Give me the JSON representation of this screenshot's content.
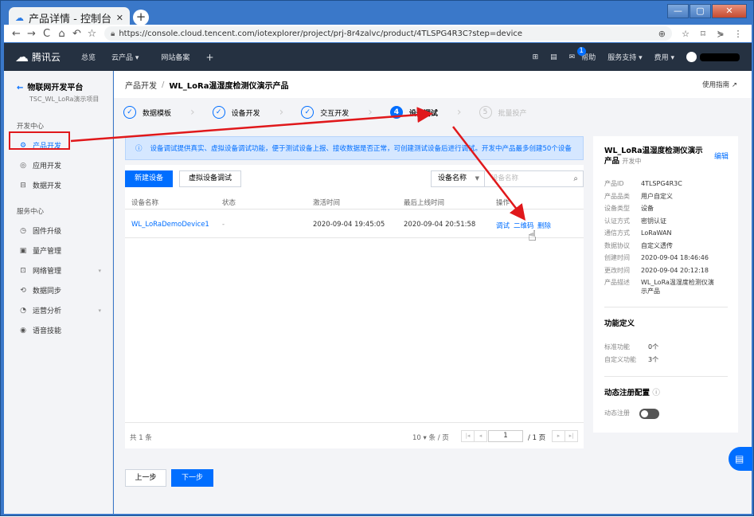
{
  "browser": {
    "tab_title": "产品详情 - 控制台",
    "tab_close": "✕",
    "new_tab": "+",
    "url": "https://console.cloud.tencent.com/iotexplorer/project/prj-8r4zalvc/product/4TLSPG4R3C?step=device",
    "nav": [
      "←",
      "→",
      "C",
      "⌂",
      "↶",
      "☆"
    ],
    "tools": [
      "⊕",
      "☆",
      "⌑",
      "⋟",
      "⋮"
    ]
  },
  "topnav": {
    "brand": "腾讯云",
    "items": [
      "总览",
      "云产品 ▾",
      "网站备案",
      "+"
    ],
    "right": {
      "icons": [
        "⊞",
        "▤"
      ],
      "mail_count": "1",
      "help": "帮助",
      "support": "服务支持 ▾",
      "billing": "费用 ▾"
    }
  },
  "sidebar": {
    "back_arrow": "←",
    "title": "物联网开发平台",
    "subtitle": "TSC_WL_LoRa演示项目",
    "section_dev": "开发中心",
    "dev_items": [
      {
        "icon": "⚙",
        "label": "产品开发"
      },
      {
        "icon": "◎",
        "label": "应用开发"
      },
      {
        "icon": "⊟",
        "label": "数据开发"
      }
    ],
    "section_svc": "服务中心",
    "svc_items": [
      {
        "icon": "◷",
        "label": "固件升级",
        "chev": ""
      },
      {
        "icon": "▣",
        "label": "量产管理",
        "chev": ""
      },
      {
        "icon": "⊡",
        "label": "网络管理",
        "chev": "▾"
      },
      {
        "icon": "⟲",
        "label": "数据同步",
        "chev": ""
      },
      {
        "icon": "◔",
        "label": "运营分析",
        "chev": "▾"
      },
      {
        "icon": "◉",
        "label": "语音技能",
        "chev": ""
      }
    ]
  },
  "breadcrumb": {
    "parent": "产品开发",
    "sep": "/",
    "current": "WL_LoRa温湿度检测仪演示产品",
    "help": "使用指南 ↗"
  },
  "steps": [
    {
      "mark": "✓",
      "label": "数据模板"
    },
    {
      "mark": "✓",
      "label": "设备开发"
    },
    {
      "mark": "✓",
      "label": "交互开发"
    },
    {
      "mark": "4",
      "label": "设备调试"
    },
    {
      "mark": "5",
      "label": "批量投产"
    }
  ],
  "step_sep": "›",
  "info": {
    "icon": "ⓘ",
    "text": "设备调试提供真实、虚拟设备调试功能，便于测试设备上报、接收数据是否正常，可创建测试设备后进行调试。开发中产品最多创建50个设备"
  },
  "toolbar": {
    "new_device": "新建设备",
    "virtual_debug": "虚拟设备调试",
    "filter": "设备名称",
    "search_placeholder": "设备名称",
    "search_icon": "⌕"
  },
  "table": {
    "headers": [
      "设备名称",
      "状态",
      "激活时间",
      "最后上线时间",
      "操作"
    ],
    "rows": [
      {
        "name": "WL_LoRaDemoDevice1",
        "status": "-",
        "activated": "2020-09-04 19:45:05",
        "last_online": "2020-09-04 20:51:58",
        "actions": [
          "调试",
          "二维码",
          "删除"
        ]
      }
    ]
  },
  "pager": {
    "total": "共 1 条",
    "page_size": "10 ▾ 条 / 页",
    "page": "1",
    "pages": "/ 1 页",
    "btns": [
      "|◂",
      "◂",
      "▸",
      "▸|"
    ]
  },
  "footer": {
    "prev": "上一步",
    "next": "下一步"
  },
  "product": {
    "title": "WL_LoRa温湿度检测仪演示产品",
    "status": "开发中",
    "edit": "编辑",
    "fields": [
      {
        "k": "产品ID",
        "v": "4TLSPG4R3C"
      },
      {
        "k": "产品品类",
        "v": "用户自定义"
      },
      {
        "k": "设备类型",
        "v": "设备"
      },
      {
        "k": "认证方式",
        "v": "密钥认证"
      },
      {
        "k": "通信方式",
        "v": "LoRaWAN"
      },
      {
        "k": "数据协议",
        "v": "自定义透传"
      },
      {
        "k": "创建时间",
        "v": "2020-09-04 18:46:46"
      },
      {
        "k": "更改时间",
        "v": "2020-09-04 20:12:18"
      },
      {
        "k": "产品描述",
        "v": "WL_LoRa温湿度检测仪演示产品"
      }
    ],
    "func_title": "功能定义",
    "func": [
      {
        "k": "标准功能",
        "v": "0个"
      },
      {
        "k": "自定义功能",
        "v": "3个"
      }
    ],
    "dyn_title": "动态注册配置",
    "dyn_icon": "ⓘ",
    "dyn_label": "动态注册"
  },
  "chat_icon": "▤",
  "cursor": "☝",
  "accent": "#006eff",
  "annotation": "#e0181b"
}
